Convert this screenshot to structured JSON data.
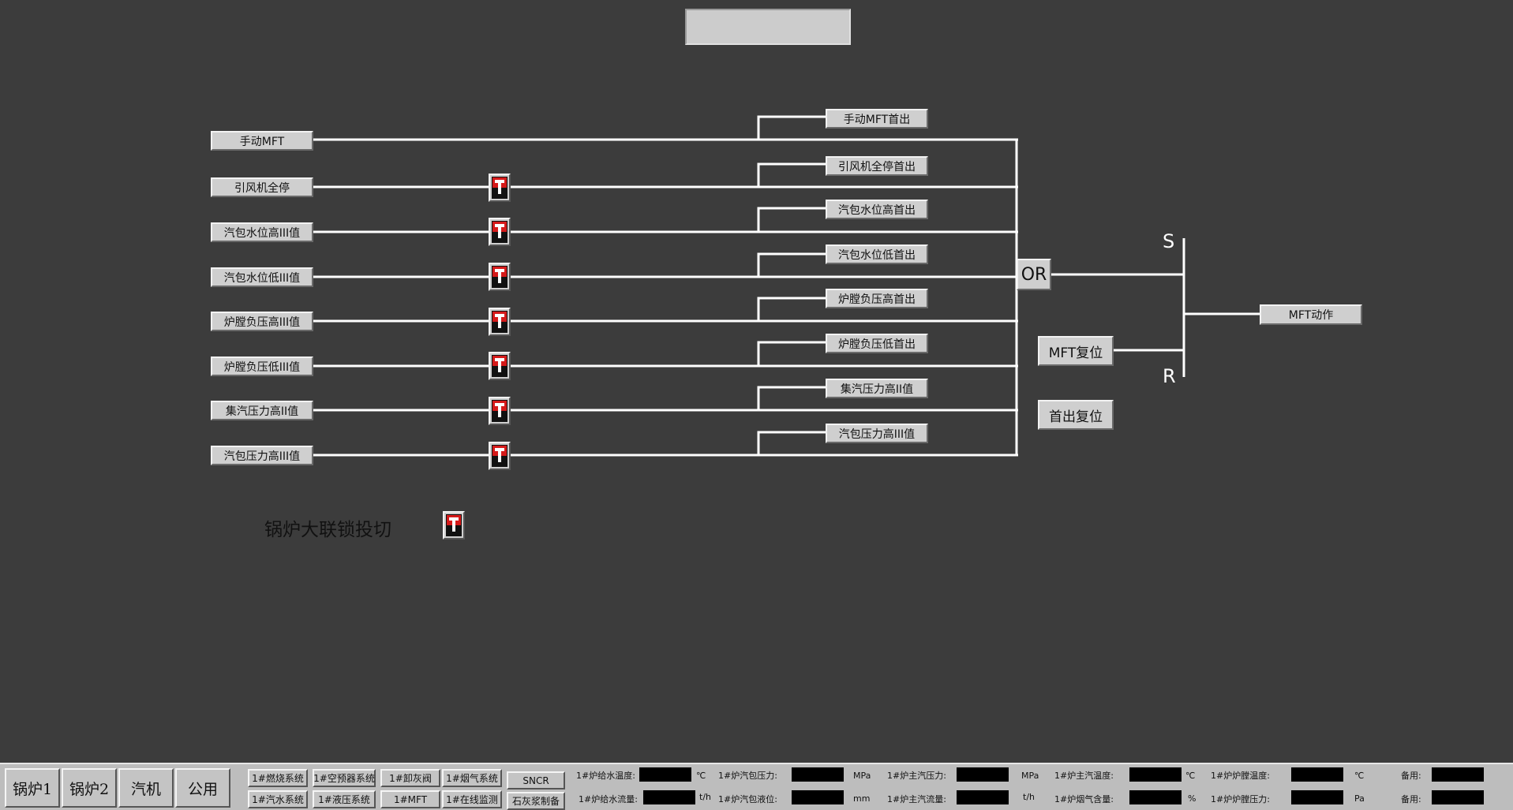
{
  "window": {
    "title_value": ""
  },
  "inputs": [
    {
      "id": "manual-mft",
      "label": "手动MFT",
      "has_toggle": false
    },
    {
      "id": "fan-stop",
      "label": "引风机全停",
      "has_toggle": true
    },
    {
      "id": "drum-high",
      "label": "汽包水位高III值",
      "has_toggle": true
    },
    {
      "id": "drum-low",
      "label": "汽包水位低III值",
      "has_toggle": true
    },
    {
      "id": "furnace-high",
      "label": "炉膛负压高III值",
      "has_toggle": true
    },
    {
      "id": "furnace-low",
      "label": "炉膛负压低III值",
      "has_toggle": true
    },
    {
      "id": "header-high",
      "label": "集汽压力高II值",
      "has_toggle": true
    },
    {
      "id": "drum-press-high",
      "label": "汽包压力高III值",
      "has_toggle": true
    }
  ],
  "first_outs": [
    "手动MFT首出",
    "引风机全停首出",
    "汽包水位高首出",
    "汽包水位低首出",
    "炉膛负压高首出",
    "炉膛负压低首出",
    "集汽压力高II值",
    "汽包压力高III值"
  ],
  "logic": {
    "or_label": "OR",
    "s_label": "S",
    "r_label": "R",
    "mft_action": "MFT动作",
    "mft_reset": "MFT复位",
    "first_reset": "首出复位"
  },
  "interlock": {
    "label": "锅炉大联锁投切"
  },
  "nav": [
    "锅炉1",
    "锅炉2",
    "汽机",
    "公用"
  ],
  "systems": [
    [
      "1#燃烧系统",
      "1#汽水系统"
    ],
    [
      "1#空预器系统",
      "1#液压系统"
    ],
    [
      "1#卸灰阀",
      "1#MFT"
    ],
    [
      "1#烟气系统",
      "1#在线监测"
    ],
    [
      "SNCR",
      "石灰浆制备"
    ]
  ],
  "status_row1": [
    {
      "label": "1#炉给水温度:",
      "unit": "℃"
    },
    {
      "label": "1#炉汽包压力:",
      "unit": "MPa"
    },
    {
      "label": "1#炉主汽压力:",
      "unit": "MPa"
    },
    {
      "label": "1#炉主汽温度:",
      "unit": "℃"
    },
    {
      "label": "1#炉炉膛温度:",
      "unit": "℃"
    },
    {
      "label": "备用:",
      "unit": ""
    }
  ],
  "status_row2": [
    {
      "label": "1#炉给水流量:",
      "unit": "t/h"
    },
    {
      "label": "1#炉汽包液位:",
      "unit": "mm"
    },
    {
      "label": "1#炉主汽流量:",
      "unit": "t/h"
    },
    {
      "label": "1#炉烟气含量:",
      "unit": "%"
    },
    {
      "label": "1#炉炉膛压力:",
      "unit": "Pa"
    },
    {
      "label": "备用:",
      "unit": ""
    }
  ],
  "colors": {
    "background": "#3c3c3c",
    "button": "#cfcfcf",
    "line": "#ffffff",
    "toggle_red": "#d51a1a"
  }
}
